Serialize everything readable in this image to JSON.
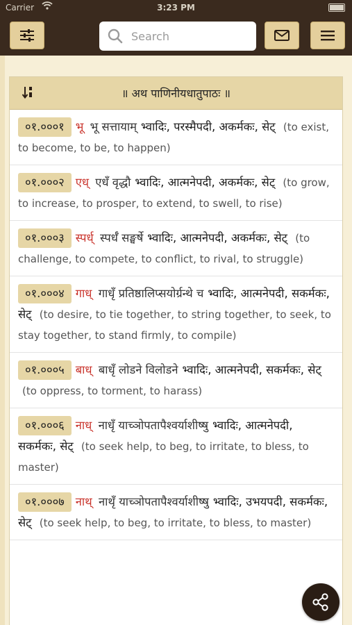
{
  "status": {
    "carrier": "Carrier",
    "time": "3:23 PM"
  },
  "search": {
    "placeholder": "Search"
  },
  "list": {
    "title": "॥ अथ पाणिनीयधातुपाठः ॥",
    "entries": [
      {
        "num": "०१.०००१",
        "root": "भू",
        "sutra": "भू सत्तायाम्",
        "meta": "भ्वादिः, परस्मैपदी, अकर्मकः, सेट्",
        "meaning": "(to exist, to become, to be, to happen)"
      },
      {
        "num": "०१.०००२",
        "root": "एध्",
        "sutra": "एधँ वृद्धौ",
        "meta": "भ्वादिः, आत्मनेपदी, अकर्मकः, सेट्",
        "meaning": "(to grow, to increase, to prosper, to extend, to swell, to rise)"
      },
      {
        "num": "०१.०००३",
        "root": "स्पर्ध्",
        "sutra": "स्पर्धँ सङ्घर्षे",
        "meta": "भ्वादिः, आत्मनेपदी, अकर्मकः, सेट्",
        "meaning": "(to challenge, to compete, to conflict, to rival, to struggle)"
      },
      {
        "num": "०१.०००४",
        "root": "गाध्",
        "sutra": "गाधृँ प्रतिष्ठालिप्सयोर्ग्रन्थे च",
        "meta": "भ्वादिः, आत्मनेपदी, सकर्मकः, सेट्",
        "meaning": "(to desire, to tie together, to string together, to seek, to stay together, to stand firmly, to compile)"
      },
      {
        "num": "०१.०००५",
        "root": "बाध्",
        "sutra": "बाधृँ लोडने विलोडने",
        "meta": "भ्वादिः, आत्मनेपदी, सकर्मकः, सेट्",
        "meaning": "(to oppress, to torment, to harass)"
      },
      {
        "num": "०१.०००६",
        "root": "नाध्",
        "sutra": "नाधृँ याच्ञोपतापैश्वर्याशीष्षु",
        "meta": "भ्वादिः, आत्मनेपदी, सकर्मकः, सेट्",
        "meaning": "(to seek help, to beg, to irritate, to bless, to master)"
      },
      {
        "num": "०१.०००७",
        "root": "नाथ्",
        "sutra": "नाथृँ याच्ञोपतापैश्वर्याशीष्षु",
        "meta": "भ्वादिः, उभयपदी, सकर्मकः, सेट्",
        "meaning": "(to seek help, to beg, to irritate, to bless, to master)"
      }
    ]
  },
  "colors": {
    "accent": "#e6d6a6",
    "root": "#c9322a",
    "navbar": "#3a2a1e"
  },
  "icons": {
    "filter": "sliders-icon",
    "mail": "mail-icon",
    "menu": "hamburger-icon",
    "share": "share-icon",
    "sort": "sort-icon",
    "search": "search-icon"
  }
}
